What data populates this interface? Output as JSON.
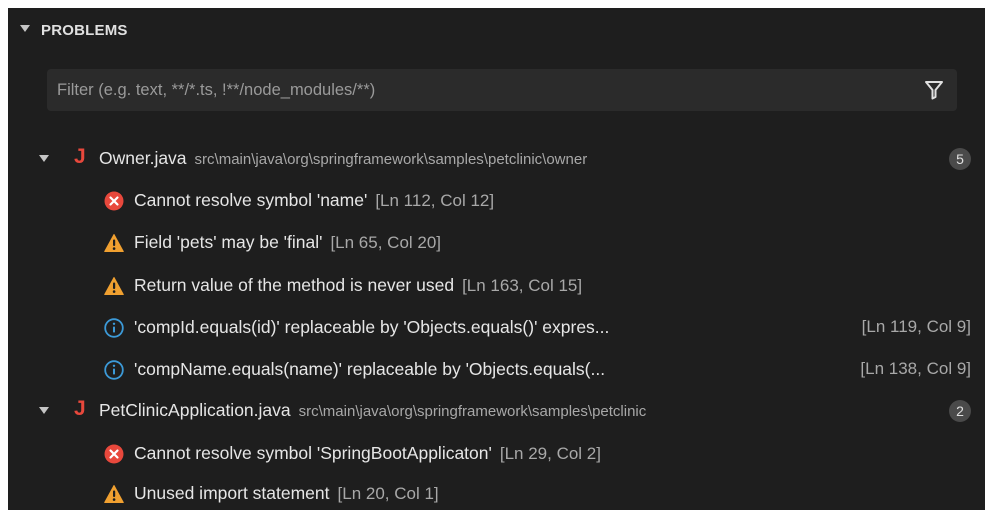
{
  "panel": {
    "title": "PROBLEMS",
    "filter_placeholder": "Filter (e.g. text, **/*.ts, !**/node_modules/**)",
    "filter_icon": "funnel-icon"
  },
  "files": [
    {
      "name": "Owner.java",
      "path": "src\\main\\java\\org\\springframework\\samples\\petclinic\\owner",
      "count": "5",
      "icon": "java-file-icon",
      "problems": [
        {
          "severity": "error",
          "message": "Cannot resolve symbol 'name'",
          "location": "[Ln 112, Col 12]"
        },
        {
          "severity": "warning",
          "message": "Field 'pets' may be 'final'",
          "location": "[Ln 65, Col 20]"
        },
        {
          "severity": "warning",
          "message": "Return value of the method is never used",
          "location": "[Ln 163, Col 15]"
        },
        {
          "severity": "info",
          "message": "'compId.equals(id)' replaceable by 'Objects.equals()' expres...",
          "location": "[Ln 119, Col 9]"
        },
        {
          "severity": "info",
          "message": "'compName.equals(name)' replaceable by 'Objects.equals(...",
          "location": "[Ln 138, Col 9]"
        }
      ]
    },
    {
      "name": "PetClinicApplication.java",
      "path": "src\\main\\java\\org\\springframework\\samples\\petclinic",
      "count": "2",
      "icon": "java-file-icon",
      "problems": [
        {
          "severity": "error",
          "message": "Cannot resolve symbol 'SpringBootApplicaton'",
          "location": "[Ln 29, Col 2]"
        },
        {
          "severity": "warning",
          "message": "Unused import statement",
          "location": "[Ln 20, Col 1]"
        }
      ]
    }
  ],
  "colors": {
    "background": "#1e1e1e",
    "error": "#e8483c",
    "warning": "#f0a030",
    "info": "#3c9ad8",
    "java": "#e8483c"
  }
}
